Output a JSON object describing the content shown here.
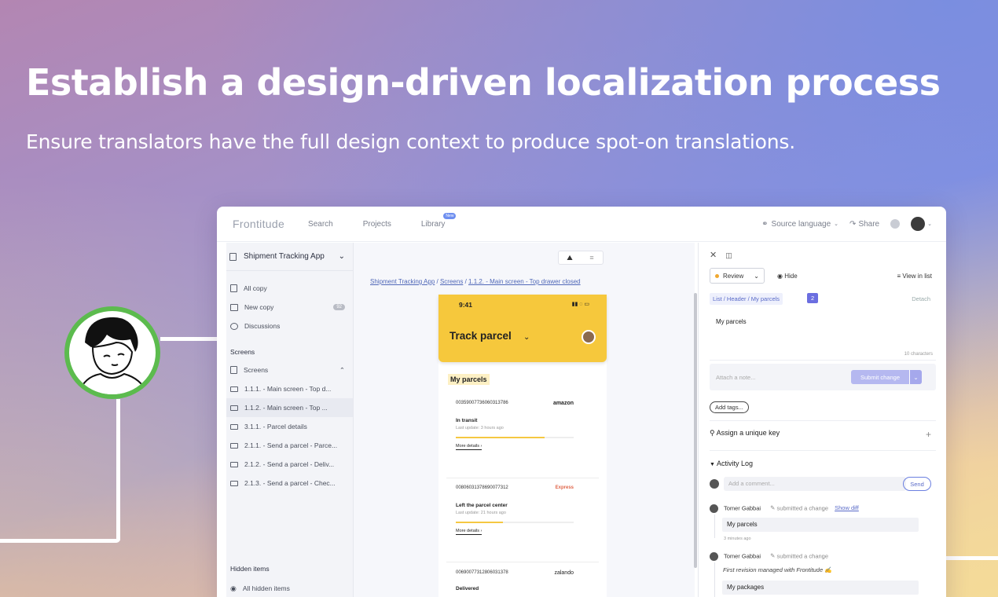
{
  "hero": {
    "title": "Establish a design-driven localization process",
    "subtitle": "Ensure translators have the full design context to produce spot-on translations."
  },
  "topbar": {
    "logo": "Frontitude",
    "nav": [
      "Search",
      "Projects",
      "Library"
    ],
    "library_badge": "New",
    "source_language": "Source language",
    "share": "Share"
  },
  "sidebar": {
    "project": "Shipment Tracking App",
    "items": [
      {
        "label": "All copy",
        "icon": "document-icon"
      },
      {
        "label": "New copy",
        "icon": "inbox-icon",
        "badge": "92"
      },
      {
        "label": "Discussions",
        "icon": "chat-icon"
      }
    ],
    "screens_header": "Screens",
    "screens_group": "Screens",
    "screens": [
      "1.1.1. - Main screen - Top d...",
      "1.1.2. - Main screen - Top ...",
      "3.1.1. - Parcel details",
      "2.1.1. - Send a parcel - Parce...",
      "2.1.2. - Send a parcel - Deliv...",
      "2.1.3. - Send a parcel - Chec..."
    ],
    "active_screen_index": 1,
    "hidden_header": "Hidden items",
    "hidden_all": "All hidden items"
  },
  "canvas": {
    "breadcrumb": [
      "Shipment Tracking App",
      "Screens",
      "1.1.2. - Main screen - Top drawer closed"
    ],
    "phone": {
      "time": "9:41",
      "title": "Track parcel",
      "section": "My parcels",
      "parcels": [
        {
          "number": "00359007736060313786",
          "carrier": "amazon",
          "status": "In transit",
          "updated": "Last update: 3 hours ago",
          "progress": 0.75,
          "more": "More details"
        },
        {
          "number": "00806031378690077312",
          "carrier": "Express",
          "status": "Left the parcel center",
          "updated": "Last update: 21 hours ago",
          "progress": 0.4,
          "more": "More details"
        },
        {
          "number": "00690077312806031378",
          "carrier": "zalando",
          "status": "Delivered",
          "updated": "",
          "progress": 0,
          "more": ""
        }
      ]
    }
  },
  "panel": {
    "review": "Review",
    "hide": "Hide",
    "view_in_list": "View in list",
    "key_path": "List / Header / My parcels",
    "key_count": "2",
    "detach": "Detach",
    "text_value": "My parcels",
    "char_count": "10 characters",
    "note_placeholder": "Attach a note...",
    "submit": "Submit change",
    "add_tags": "Add tags...",
    "assign_key": "Assign a unique key",
    "activity_log": "Activity Log",
    "comment_placeholder": "Add a comment...",
    "send": "Send",
    "log": [
      {
        "user": "Tomer Gabbai",
        "action": "submitted a change",
        "diff": "Show diff",
        "value": "My parcels",
        "time": "3 minutes ago"
      },
      {
        "user": "Tomer Gabbai",
        "action": "submitted a change",
        "note": "First revision managed with Frontitude ✍",
        "value": "My packages"
      }
    ]
  },
  "colors": {
    "accent": "#6b6ee0",
    "phone_header": "#f6c83c",
    "avatar_ring": "#5cbb4e"
  }
}
